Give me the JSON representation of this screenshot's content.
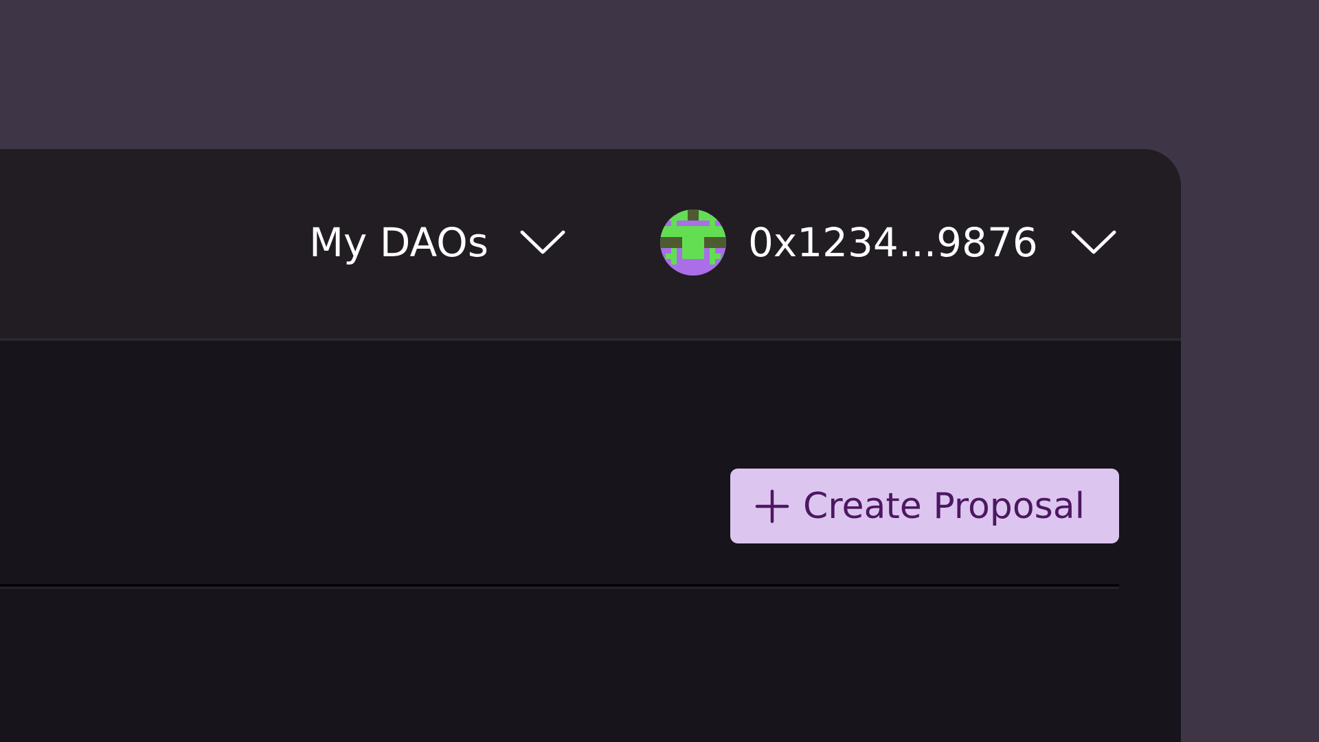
{
  "header": {
    "my_daos_label": "My DAOs",
    "wallet_address": "0x1234...9876",
    "daos_chevron_icon": "chevron-down-icon",
    "wallet_chevron_icon": "chevron-down-icon",
    "avatar_icon": "pixel-avatar-icon"
  },
  "main": {
    "create_proposal_label": "Create Proposal",
    "create_proposal_icon": "plus-icon"
  },
  "colors": {
    "page_background": "#3e3646",
    "header_background": "#211d23",
    "content_background": "#17141b",
    "button_background": "#dcc6f0",
    "button_text": "#4d1760",
    "avatar_purple": "#a96ee8",
    "avatar_green": "#63de53",
    "avatar_dark_green": "#4e5b30"
  }
}
